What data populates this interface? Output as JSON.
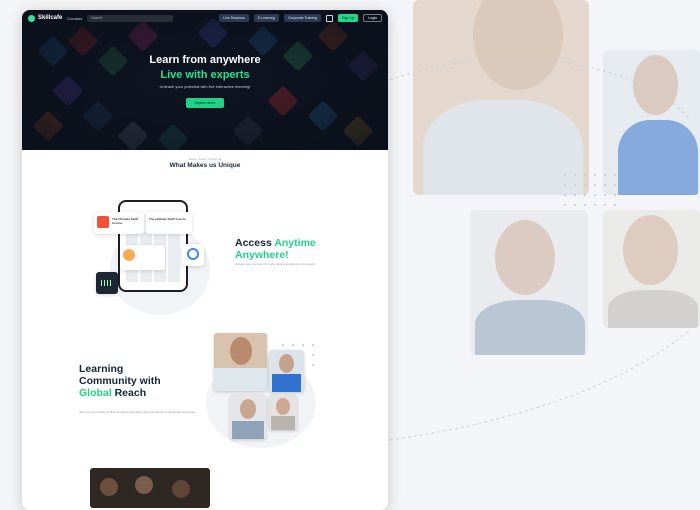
{
  "nav": {
    "logo": "Skillcafe",
    "courses": "Courses",
    "search_placeholder": "Search",
    "buttons": [
      "Live Sessions",
      "E-Learning",
      "Corporate Training"
    ],
    "signup": "Sign Up",
    "login": "Login"
  },
  "hero": {
    "title": "Learn from anywhere",
    "subtitle": "Live with experts",
    "tagline": "Unleash your potential with live interactive learning!",
    "cta": "Explore More"
  },
  "unique": {
    "breadcrumb": "Home  /  Learn  /  About us",
    "title": "What Makes us Unique"
  },
  "access": {
    "title_1": "Access",
    "title_green_1": "Anytime",
    "title_green_2": "Anywhere!",
    "sub": "Access your courses from any device anywhere in the world",
    "phone_cards": [
      "The Ultimate Swift Course",
      "The ultimate Swift Course"
    ]
  },
  "community": {
    "line1": "Learning",
    "line2": "Community with",
    "green": "Global",
    "line3_rest": " Reach",
    "sub": "Join our Community of diverse learners working with companies of all shapes and sizes"
  },
  "colors": {
    "accent": "#21d88b",
    "hero_bg": "#111b28",
    "heading": "#16253a"
  }
}
